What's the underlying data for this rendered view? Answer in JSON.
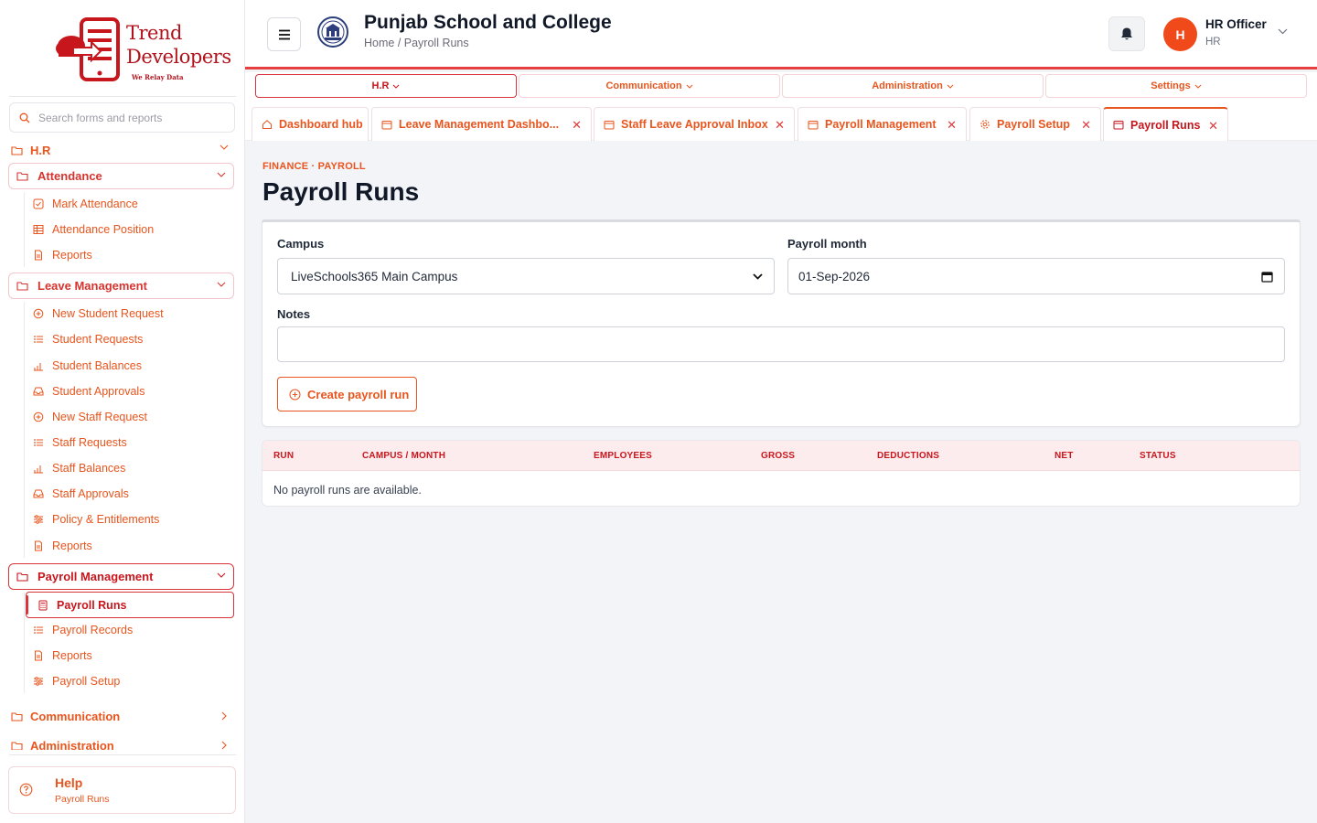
{
  "brand": {
    "line1": "Trend",
    "line2": "Developers",
    "tagline": "We Relay Data"
  },
  "search": {
    "placeholder": "Search forms and reports"
  },
  "sidebar": {
    "section_hr": "H.R",
    "attendance": {
      "label": "Attendance",
      "items": [
        "Mark Attendance",
        "Attendance Position",
        "Reports"
      ]
    },
    "leave": {
      "label": "Leave Management",
      "items": [
        "New Student Request",
        "Student Requests",
        "Student Balances",
        "Student Approvals",
        "New Staff Request",
        "Staff Requests",
        "Staff Balances",
        "Staff Approvals",
        "Policy & Entitlements",
        "Reports"
      ]
    },
    "payroll": {
      "label": "Payroll Management",
      "items": [
        "Payroll Runs",
        "Payroll Records",
        "Reports",
        "Payroll Setup"
      ]
    },
    "section_communication": "Communication",
    "section_administration": "Administration"
  },
  "help": {
    "title": "Help",
    "subtitle": "Payroll Runs"
  },
  "header": {
    "school_name": "Punjab School and College",
    "breadcrumb": "Home / Payroll Runs",
    "user_initial": "H",
    "user_name": "HR Officer",
    "user_role": "HR"
  },
  "modules": [
    "H.R",
    "Communication",
    "Administration",
    "Settings"
  ],
  "tabs": [
    "Dashboard hub",
    "Leave Management Dashbo...",
    "Staff Leave Approval Inbox",
    "Payroll Management",
    "Payroll Setup",
    "Payroll Runs"
  ],
  "page": {
    "eyebrow": "FINANCE · PAYROLL",
    "title": "Payroll Runs"
  },
  "form": {
    "campus_label": "Campus",
    "campus_value": "LiveSchools365 Main Campus",
    "month_label": "Payroll month",
    "month_value": "01-Sep-2026",
    "notes_label": "Notes",
    "notes_value": "",
    "create_label": "Create payroll run"
  },
  "table": {
    "columns": [
      "RUN",
      "CAMPUS / MONTH",
      "EMPLOYEES",
      "GROSS",
      "DEDUCTIONS",
      "NET",
      "STATUS"
    ],
    "empty_message": "No payroll runs are available."
  },
  "colors": {
    "accent": "#e8551e",
    "brand_red": "#c8161d",
    "header_underline": "#e53f3f"
  }
}
